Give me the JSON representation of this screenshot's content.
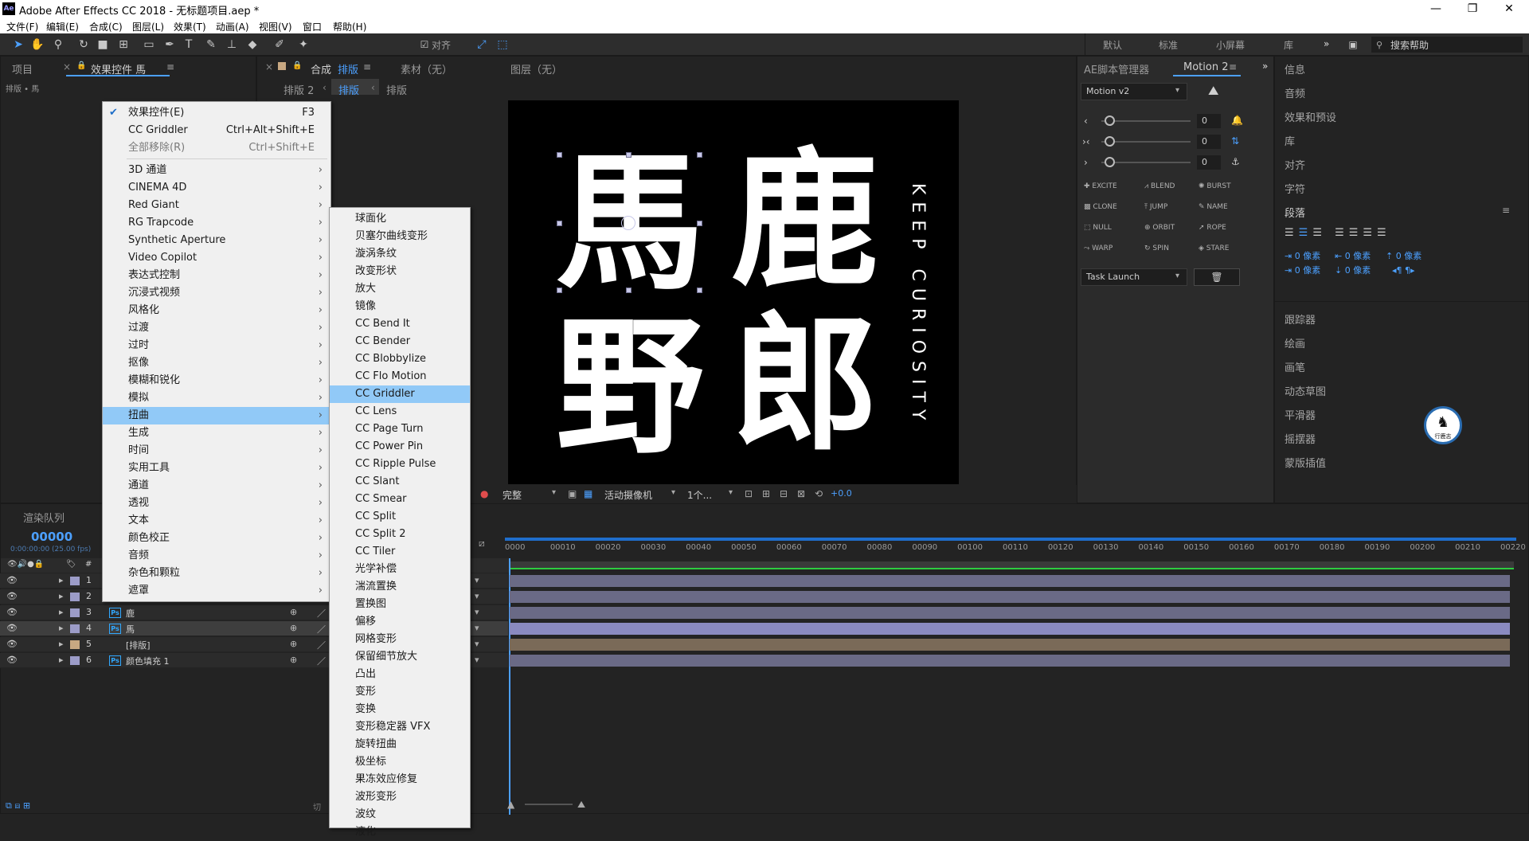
{
  "window": {
    "logo": "Ae",
    "title": "Adobe After Effects CC 2018 - 无标题项目.aep *",
    "controls": [
      "—",
      "❐",
      "✕"
    ]
  },
  "menubar": [
    "文件(F)",
    "编辑(E)",
    "合成(C)",
    "图层(L)",
    "效果(T)",
    "动画(A)",
    "视图(V)",
    "窗口",
    "帮助(H)"
  ],
  "toolbar": {
    "align_label": "对齐",
    "workspaces": [
      "默认",
      "标准",
      "小屏幕",
      "库"
    ],
    "more": "»",
    "search_placeholder": "搜索帮助"
  },
  "project_panel": {
    "tab_project": "项目",
    "tab_effects": "效果控件 馬",
    "subtitle": "排版 • 馬"
  },
  "comp_panel": {
    "tab_comp_prefix": "合成",
    "tab_comp_name": "排版",
    "tab_footage": "素材（无）",
    "tab_layer": "图层（无）",
    "breadcrumb_prev": "排版 2",
    "breadcrumb_current": "排版"
  },
  "viewer_footer": {
    "quality": "完整",
    "camera": "活动摄像机",
    "views": "1个...",
    "exposure": "+0.0"
  },
  "artwork": {
    "chars": [
      "馬",
      "鹿",
      "野",
      "郎"
    ],
    "vertical_text": "KEEP CURIOSITY"
  },
  "script_panel": {
    "tab1": "AE脚本管理器",
    "tab2": "Motion 2",
    "dropdown": "Motion v2",
    "slider_values": [
      "0",
      "0",
      "0"
    ],
    "buttons": [
      "EXCITE",
      "BLEND",
      "BURST",
      "CLONE",
      "JUMP",
      "NAME",
      "NULL",
      "ORBIT",
      "ROPE",
      "WARP",
      "SPIN",
      "STARE"
    ],
    "task": "Task Launch"
  },
  "right_panel": {
    "items_top": [
      "信息",
      "音频",
      "效果和预设",
      "库",
      "对齐",
      "字符"
    ],
    "paragraph_title": "段落",
    "indent_values": [
      "0 像素",
      "0 像素",
      "0 像素",
      "0 像素",
      "0 像素"
    ],
    "items_bottom": [
      "跟踪器",
      "绘画",
      "画笔",
      "动态草图",
      "平滑器",
      "摇摆器",
      "蒙版插值"
    ],
    "watermark": "行鹿志"
  },
  "menu1": [
    {
      "label": "效果控件(E)",
      "shortcut": "F3",
      "checked": true
    },
    {
      "label": "CC Griddler",
      "shortcut": "Ctrl+Alt+Shift+E"
    },
    {
      "label": "全部移除(R)",
      "shortcut": "Ctrl+Shift+E",
      "disabled": true
    },
    {
      "label": "3D 通道",
      "sub": true
    },
    {
      "label": "CINEMA 4D",
      "sub": true
    },
    {
      "label": "Red Giant",
      "sub": true
    },
    {
      "label": "RG Trapcode",
      "sub": true
    },
    {
      "label": "Synthetic Aperture",
      "sub": true
    },
    {
      "label": "Video Copilot",
      "sub": true
    },
    {
      "label": "表达式控制",
      "sub": true
    },
    {
      "label": "沉浸式视频",
      "sub": true
    },
    {
      "label": "风格化",
      "sub": true
    },
    {
      "label": "过渡",
      "sub": true
    },
    {
      "label": "过时",
      "sub": true
    },
    {
      "label": "抠像",
      "sub": true
    },
    {
      "label": "模糊和锐化",
      "sub": true
    },
    {
      "label": "模拟",
      "sub": true
    },
    {
      "label": "扭曲",
      "sub": true,
      "highlight": true
    },
    {
      "label": "生成",
      "sub": true
    },
    {
      "label": "时间",
      "sub": true
    },
    {
      "label": "实用工具",
      "sub": true
    },
    {
      "label": "通道",
      "sub": true
    },
    {
      "label": "透视",
      "sub": true
    },
    {
      "label": "文本",
      "sub": true
    },
    {
      "label": "颜色校正",
      "sub": true
    },
    {
      "label": "音频",
      "sub": true
    },
    {
      "label": "杂色和颗粒",
      "sub": true
    },
    {
      "label": "遮罩",
      "sub": true
    }
  ],
  "menu2": [
    "球面化",
    "贝塞尔曲线变形",
    "漩涡条纹",
    "改变形状",
    "放大",
    "镜像",
    "CC Bend It",
    "CC Bender",
    "CC Blobbylize",
    "CC Flo Motion",
    "CC Griddler",
    "CC Lens",
    "CC Page Turn",
    "CC Power Pin",
    "CC Ripple Pulse",
    "CC Slant",
    "CC Smear",
    "CC Split",
    "CC Split 2",
    "CC Tiler",
    "光学补偿",
    "湍流置换",
    "置换图",
    "偏移",
    "网格变形",
    "保留细节放大",
    "凸出",
    "变形",
    "变换",
    "变形稳定器 VFX",
    "旋转扭曲",
    "极坐标",
    "果冻效应修复",
    "波形变形",
    "波纹",
    "液化"
  ],
  "menu2_highlight": 10,
  "timeline": {
    "tab": "渲染队列",
    "timecode": "00000",
    "timecode_sub": "0:00:00:00 (25.00 fps)",
    "col_num": "#",
    "bottom_label": "切",
    "ticks": [
      "0000",
      "00010",
      "00020",
      "00030",
      "00040",
      "00050",
      "00060",
      "00070",
      "00080",
      "00090",
      "00100",
      "00110",
      "00120",
      "00130",
      "00140",
      "00150",
      "00160",
      "00170",
      "00180",
      "00190",
      "00200",
      "00210",
      "00220"
    ],
    "layers": [
      {
        "num": "1",
        "name": "",
        "color": "#9c9cc8"
      },
      {
        "num": "2",
        "name": "",
        "color": "#9c9cc8"
      },
      {
        "num": "3",
        "name": "鹿",
        "color": "#9c9cc8",
        "ps": true
      },
      {
        "num": "4",
        "name": "馬",
        "color": "#9c9cc8",
        "ps": true,
        "selected": true
      },
      {
        "num": "5",
        "name": "[排版]",
        "color": "#c8a882"
      },
      {
        "num": "6",
        "name": "颜色填充 1",
        "color": "#9c9cc8",
        "ps": true
      }
    ]
  }
}
